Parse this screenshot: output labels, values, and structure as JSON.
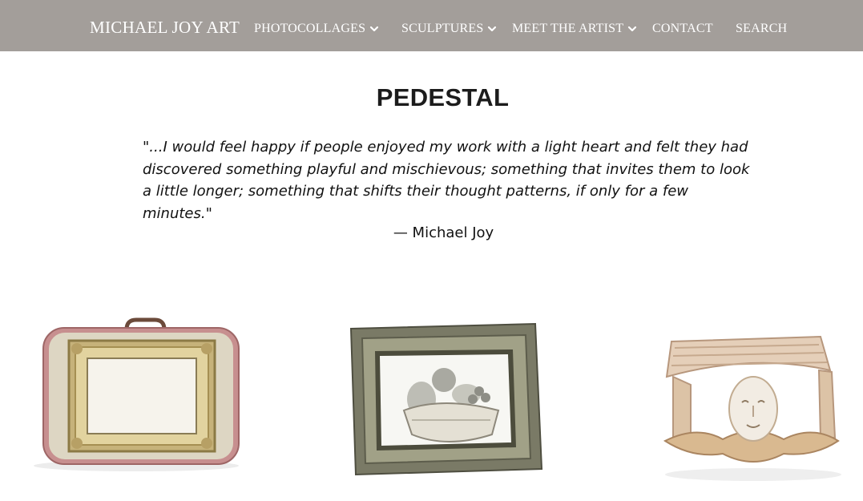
{
  "header": {
    "brand": "MICHAEL JOY ART",
    "nav": [
      {
        "label": "PHOTOCOLLAGES",
        "has_dropdown": true
      },
      {
        "label": "SCULPTURES",
        "has_dropdown": true
      },
      {
        "label": "MEET THE ARTIST",
        "has_dropdown": true
      },
      {
        "label": "CONTACT",
        "has_dropdown": false
      },
      {
        "label": "SEARCH",
        "has_dropdown": false
      }
    ],
    "background": "#a39e9a"
  },
  "main": {
    "title": "PEDESTAL",
    "quote": "\"...I would feel happy if people enjoyed my work with a light heart and felt they had discovered something playful and mischievous; something that invites them to look a little longer; something that shifts their thought patterns, if only for a  few minutes.\"",
    "attribution": "— Michael Joy",
    "gallery": [
      {
        "subject": "suitcase with ornate gilded frame",
        "icon": "suitcase-frame-sculpture"
      },
      {
        "subject": "ornate frame with bowl of stone fruit",
        "icon": "frame-fruit-bowl-sculpture"
      },
      {
        "subject": "carved face pedestal with radiating ribs",
        "icon": "face-pedestal-sculpture"
      }
    ]
  }
}
